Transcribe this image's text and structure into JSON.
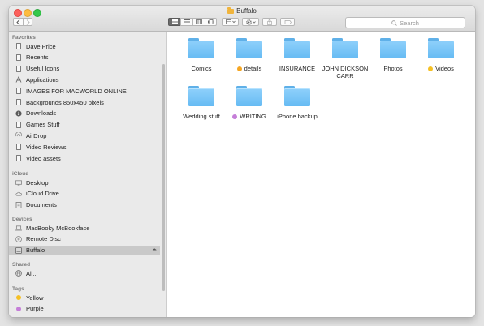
{
  "window": {
    "title": "Buffalo"
  },
  "toolbar": {
    "back_icon": "chevron-left-icon",
    "forward_icon": "chevron-right-icon",
    "search_placeholder": "Search"
  },
  "sidebar": {
    "sections": [
      {
        "label": "Favorites",
        "items": [
          {
            "label": "Dave Price",
            "icon": "document-icon"
          },
          {
            "label": "Recents",
            "icon": "document-icon"
          },
          {
            "label": "Useful Icons",
            "icon": "document-icon"
          },
          {
            "label": "Applications",
            "icon": "applications-icon"
          },
          {
            "label": "IMAGES FOR MACWORLD ONLINE",
            "icon": "document-icon"
          },
          {
            "label": "Backgrounds 850x450 pixels",
            "icon": "document-icon"
          },
          {
            "label": "Downloads",
            "icon": "downloads-icon"
          },
          {
            "label": "Games Stuff",
            "icon": "document-icon"
          },
          {
            "label": "AirDrop",
            "icon": "airdrop-icon"
          },
          {
            "label": "Video Reviews",
            "icon": "document-icon"
          },
          {
            "label": "Video assets",
            "icon": "document-icon"
          }
        ]
      },
      {
        "label": "iCloud",
        "items": [
          {
            "label": "Desktop",
            "icon": "desktop-icon"
          },
          {
            "label": "iCloud Drive",
            "icon": "cloud-icon"
          },
          {
            "label": "Documents",
            "icon": "documents-icon"
          }
        ]
      },
      {
        "label": "Devices",
        "items": [
          {
            "label": "MacBooky McBookface",
            "icon": "laptop-icon"
          },
          {
            "label": "Remote Disc",
            "icon": "disc-icon"
          },
          {
            "label": "Buffalo",
            "icon": "drive-icon",
            "selected": true
          }
        ]
      },
      {
        "label": "Shared",
        "items": [
          {
            "label": "All...",
            "icon": "network-icon"
          }
        ]
      },
      {
        "label": "Tags",
        "items": [
          {
            "label": "Yellow",
            "icon": "tag-yellow-icon"
          },
          {
            "label": "Purple",
            "icon": "tag-purple-icon"
          }
        ]
      }
    ]
  },
  "colors": {
    "tag_yellow": "#f5c024",
    "tag_orange": "#f5a623",
    "tag_purple": "#c57ed8",
    "folder_blue": "#6fbff5"
  },
  "folders": [
    {
      "name": "Comics"
    },
    {
      "name": "details",
      "tag": "#f5a623"
    },
    {
      "name": "INSURANCE"
    },
    {
      "name": "JOHN DICKSON CARR"
    },
    {
      "name": "Photos"
    },
    {
      "name": "Videos",
      "tag": "#f5c024"
    },
    {
      "name": "Wedding stuff"
    },
    {
      "name": "WRITING",
      "tag": "#c57ed8"
    },
    {
      "name": "iPhone backup"
    }
  ]
}
